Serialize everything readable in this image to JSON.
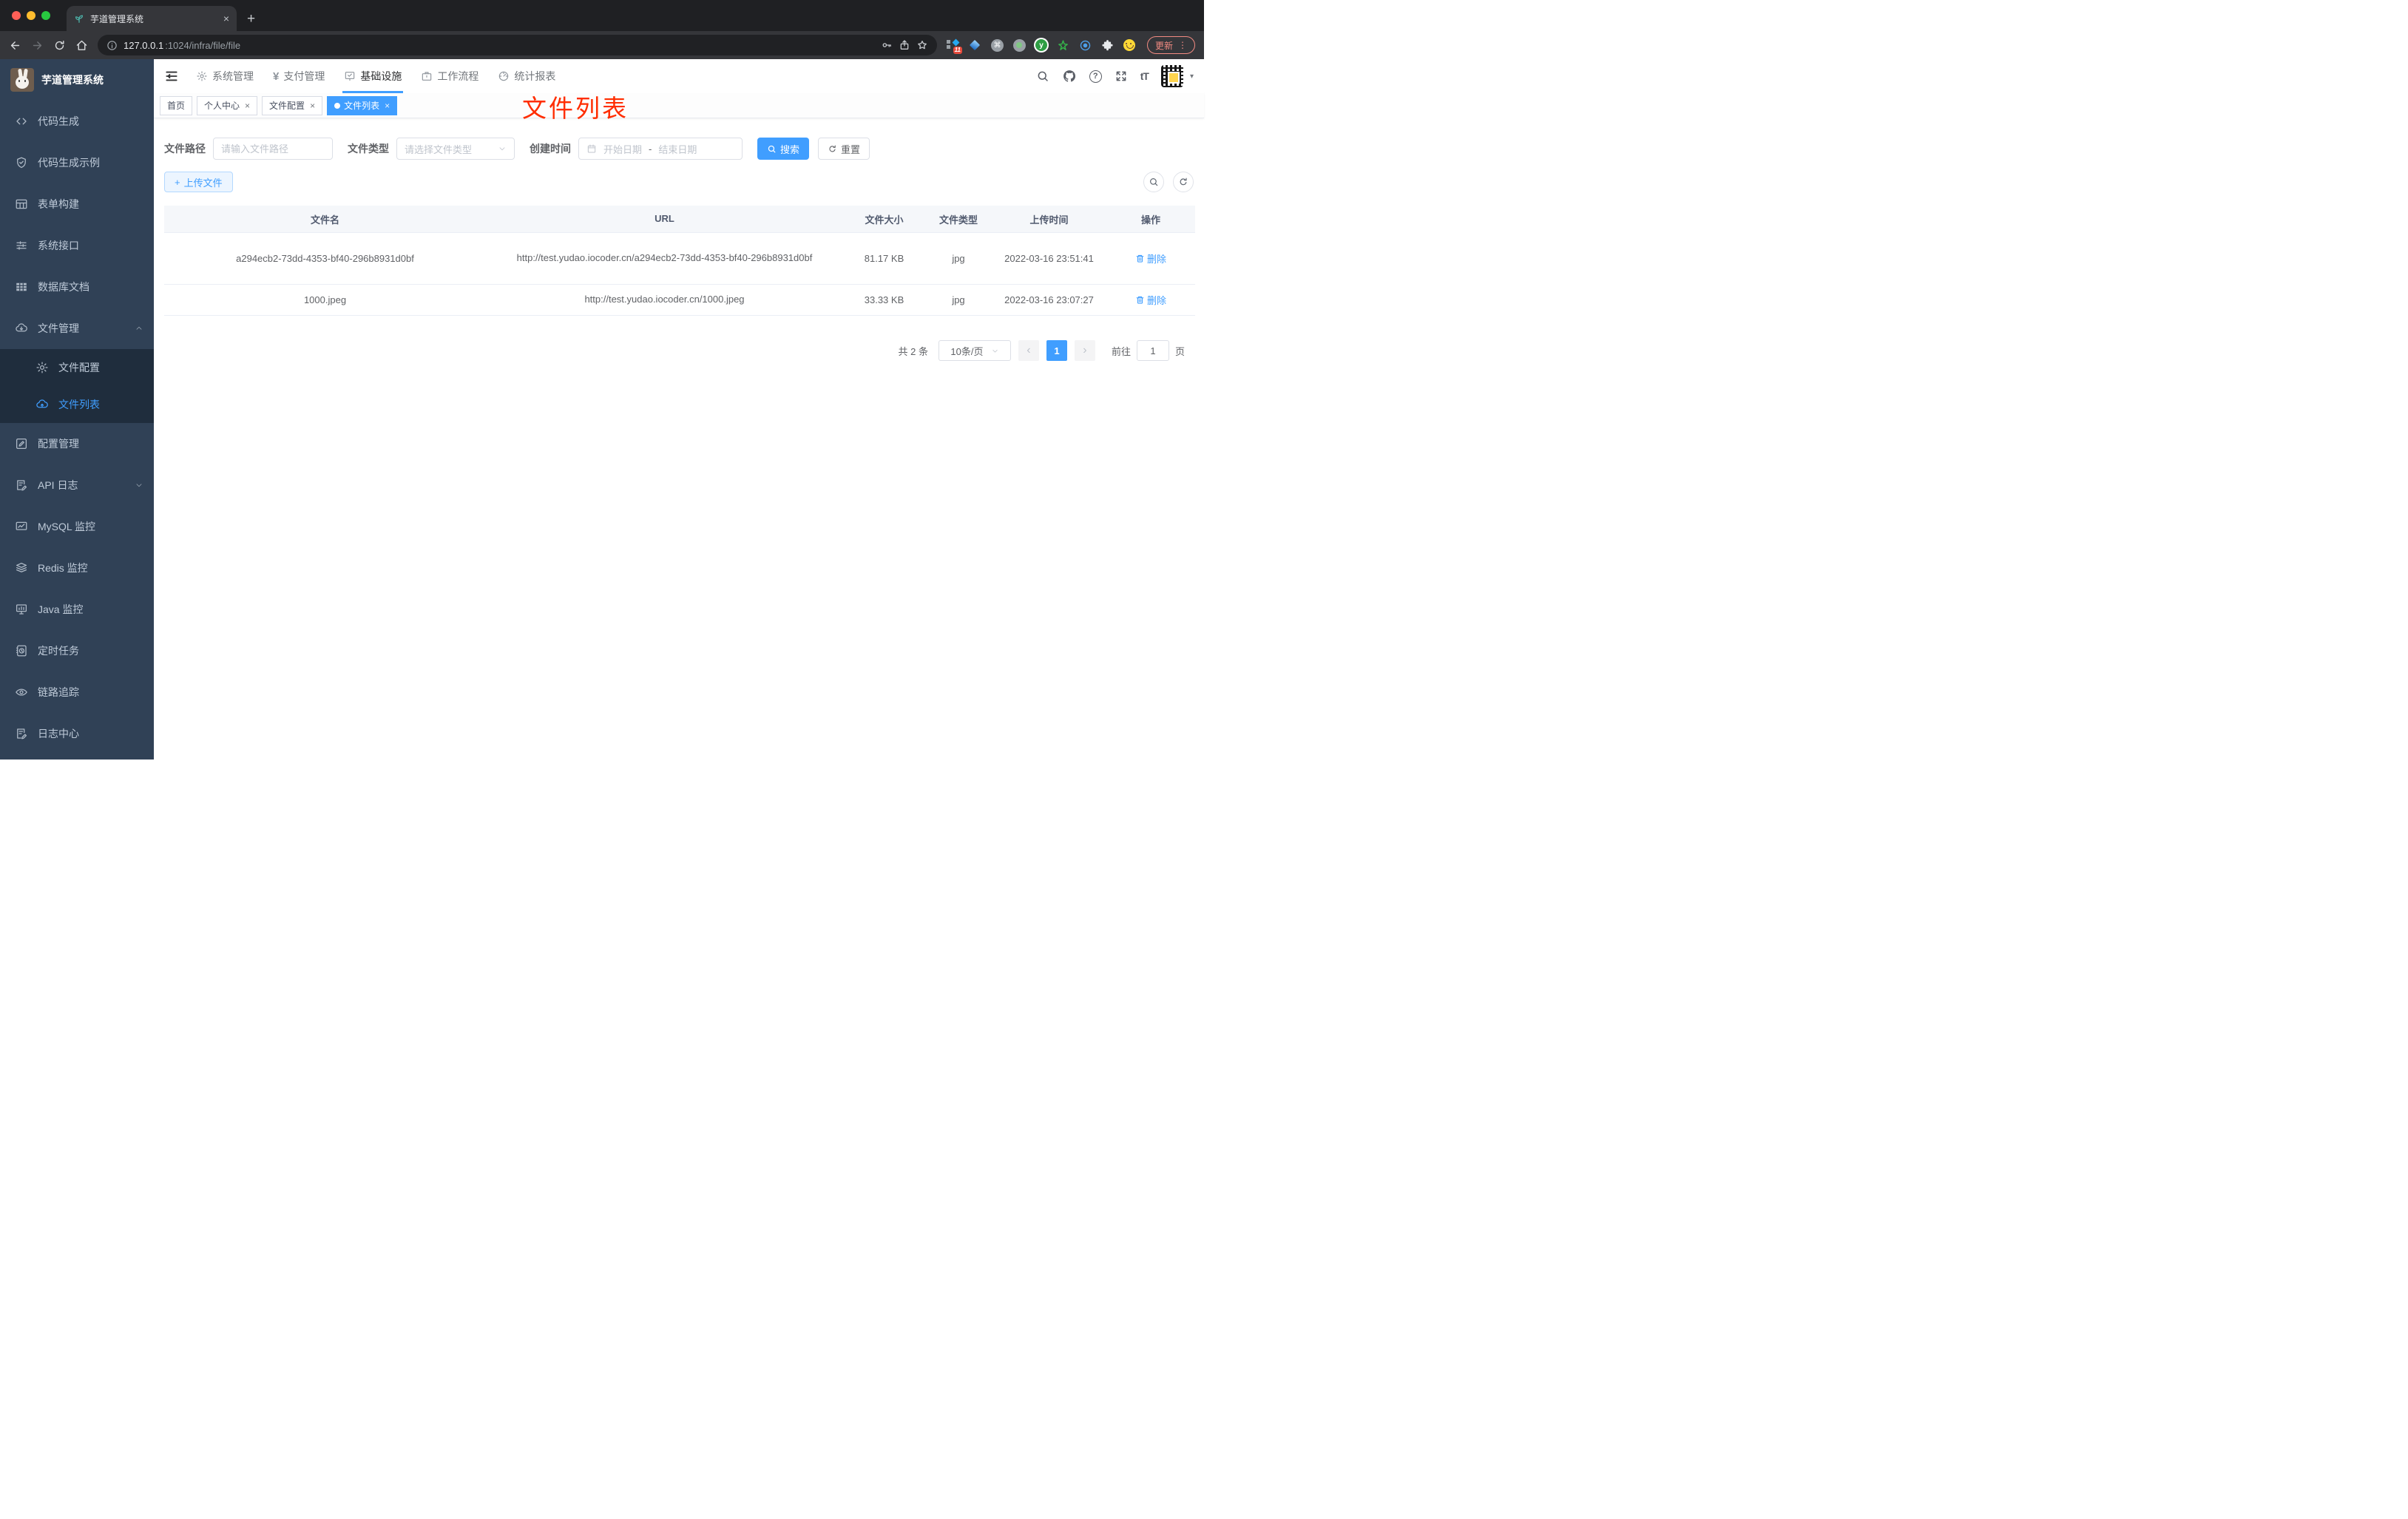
{
  "browser": {
    "tab_title": "芋道管理系统",
    "url_host": "127.0.0.1",
    "url_path": ":1024/infra/file/file",
    "update_label": "更新",
    "extension_badge": "11"
  },
  "glyphs": {
    "close": "×",
    "plus": "+",
    "prev": "‹",
    "next": "›",
    "kebab": "⋮",
    "caret_down": "▾",
    "question": "?",
    "yen": "¥",
    "font_size": "tT",
    "command": "⌘",
    "y_letter": "y"
  },
  "sidebar": {
    "title": "芋道管理系统",
    "items": [
      {
        "label": "代码生成"
      },
      {
        "label": "代码生成示例"
      },
      {
        "label": "表单构建"
      },
      {
        "label": "系统接口"
      },
      {
        "label": "数据库文档"
      },
      {
        "label": "文件管理"
      },
      {
        "label": "文件配置"
      },
      {
        "label": "文件列表"
      },
      {
        "label": "配置管理"
      },
      {
        "label": "API 日志"
      },
      {
        "label": "MySQL 监控"
      },
      {
        "label": "Redis 监控"
      },
      {
        "label": "Java 监控"
      },
      {
        "label": "定时任务"
      },
      {
        "label": "链路追踪"
      },
      {
        "label": "日志中心"
      }
    ]
  },
  "navbar": {
    "menus": [
      {
        "label": "系统管理"
      },
      {
        "label": "支付管理"
      },
      {
        "label": "基础设施"
      },
      {
        "label": "工作流程"
      },
      {
        "label": "统计报表"
      }
    ]
  },
  "tags": [
    {
      "label": "首页"
    },
    {
      "label": "个人中心"
    },
    {
      "label": "文件配置"
    },
    {
      "label": "文件列表"
    }
  ],
  "annotation": {
    "text": "文件列表",
    "color": "#ff2d00"
  },
  "filters": {
    "path_label": "文件路径",
    "path_placeholder": "请输入文件路径",
    "type_label": "文件类型",
    "type_placeholder": "请选择文件类型",
    "date_label": "创建时间",
    "date_start": "开始日期",
    "date_separator": "-",
    "date_end": "结束日期",
    "search_label": "搜索",
    "reset_label": "重置"
  },
  "toolbar": {
    "upload_label": "上传文件"
  },
  "table": {
    "columns": [
      "文件名",
      "URL",
      "文件大小",
      "文件类型",
      "上传时间",
      "操作"
    ],
    "rows": [
      {
        "name": "a294ecb2-73dd-4353-bf40-296b8931d0bf",
        "url": "http://test.yudao.iocoder.cn/a294ecb2-73dd-4353-bf40-296b8931d0bf",
        "size": "81.17 KB",
        "type": "jpg",
        "time": "2022-03-16 23:51:41",
        "action": "删除"
      },
      {
        "name": "1000.jpeg",
        "url": "http://test.yudao.iocoder.cn/1000.jpeg",
        "size": "33.33 KB",
        "type": "jpg",
        "time": "2022-03-16 23:07:27",
        "action": "删除"
      }
    ]
  },
  "pagination": {
    "total": "共 2 条",
    "page_size": "10条/页",
    "current_page": "1",
    "goto_label": "前往",
    "jump_value": "1",
    "page_unit": "页"
  },
  "colors": {
    "accent": "#409eff",
    "sidebar_bg": "#304156",
    "submenu_bg": "#1f2d3d",
    "annotation_red": "#ff2d00"
  }
}
